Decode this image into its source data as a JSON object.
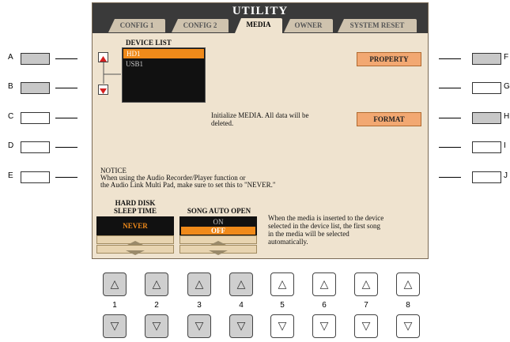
{
  "screen": {
    "title": "UTILITY",
    "tabs": [
      "CONFIG 1",
      "CONFIG 2",
      "MEDIA",
      "OWNER",
      "SYSTEM RESET"
    ],
    "active_tab": "MEDIA",
    "device_list": {
      "label": "DEVICE LIST",
      "items": [
        "HD1",
        "USB1"
      ],
      "selected": "HD1"
    },
    "property_button": "PROPERTY",
    "format_text_line1": "Initialize MEDIA. All data will be",
    "format_text_line2": "deleted.",
    "format_button": "FORMAT",
    "notice": {
      "title": "NOTICE",
      "line1": "When using the Audio Recorder/Player function or",
      "line2": "the Audio Link Multi Pad, make sure to set this to \"NEVER.\""
    },
    "sleep": {
      "label_line1": "HARD DISK",
      "label_line2": "SLEEP TIME",
      "value": "NEVER"
    },
    "song_auto_open": {
      "label": "SONG AUTO OPEN",
      "options": [
        "ON",
        "OFF"
      ],
      "selected": "OFF"
    },
    "media_help": {
      "line1": "When the media is inserted to the device",
      "line2": "selected in the device list, the first song",
      "line3": "in the media will be selected",
      "line4": "automatically."
    }
  },
  "side_buttons_left": [
    "A",
    "B",
    "C",
    "D",
    "E"
  ],
  "side_buttons_right": [
    "F",
    "G",
    "H",
    "I",
    "J"
  ],
  "bottom_buttons": {
    "numbers": [
      "1",
      "2",
      "3",
      "4",
      "5",
      "6",
      "7",
      "8"
    ],
    "up_glyph": "△",
    "down_glyph": "▽"
  },
  "colors": {
    "screen_bg": "#efe3cf",
    "highlight": "#f08a1a",
    "button_orange": "#f2a872",
    "titlebar": "#3a3a3a"
  }
}
